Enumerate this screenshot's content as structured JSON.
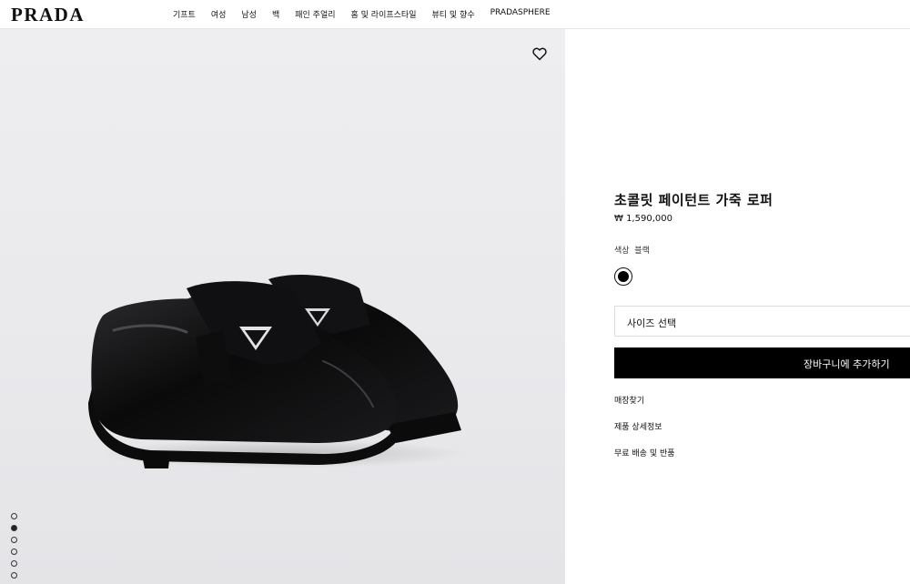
{
  "header": {
    "logo": "PRADA",
    "nav": [
      "기프트",
      "여성",
      "남성",
      "백",
      "패인 주얼리",
      "홈 및 라이프스타일",
      "뷰티 및 향수",
      "PRADASPHERE"
    ]
  },
  "gallery": {
    "image_alt": "초콜릿 페이턴트 가죽 로퍼",
    "slide_count": 7,
    "active_slide_index": 1
  },
  "product": {
    "title": "초콜릿 페이턴트 가죽 로퍼",
    "price": "₩ 1,590,000",
    "color_label": "색상",
    "color_value": "블랙",
    "swatch_color": "#000000",
    "size_placeholder": "사이즈 선택",
    "add_to_cart": "장바구니에 추가하기",
    "links": [
      "매장찾기",
      "제품 상세정보",
      "무료 배송 및 반품"
    ]
  }
}
